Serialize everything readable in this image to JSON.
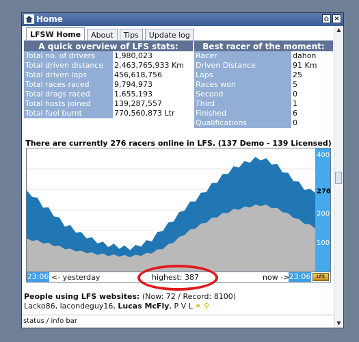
{
  "window": {
    "title": "Home",
    "controls": [
      "⌂",
      "×"
    ]
  },
  "tabs": [
    {
      "label": "LFSW Home",
      "active": true
    },
    {
      "label": "About",
      "active": false
    },
    {
      "label": "Tips",
      "active": false
    },
    {
      "label": "Update log",
      "active": false
    }
  ],
  "overview": {
    "header": "A quick overview of LFS stats:",
    "rows": [
      {
        "label": "Total no. of drivers",
        "value": "1,980,023"
      },
      {
        "label": "Total driven distance",
        "value": "2,463,765,933 Km"
      },
      {
        "label": "Total driven laps",
        "value": "456,618,756"
      },
      {
        "label": "Total races raced",
        "value": "9,794,973"
      },
      {
        "label": "Total drags raced",
        "value": "1,655,193"
      },
      {
        "label": "Total hosts joined",
        "value": "139,287,557"
      },
      {
        "label": "Total fuel burnt",
        "value": "770,560,873 Ltr"
      }
    ]
  },
  "best_racer": {
    "header": "Best racer of the moment:",
    "rows": [
      {
        "label": "Racer",
        "value": "dahon"
      },
      {
        "label": "Driven Distance",
        "value": "91 Km"
      },
      {
        "label": "Laps",
        "value": "25"
      },
      {
        "label": "Races won",
        "value": "5"
      },
      {
        "label": "Second",
        "value": "0"
      },
      {
        "label": "Third",
        "value": "1"
      },
      {
        "label": "Finished",
        "value": "6"
      },
      {
        "label": "Qualifications",
        "value": "0"
      }
    ]
  },
  "online_text": "There are currently 276 racers online in LFS. (137 Demo - 139 Licensed)",
  "graph": {
    "current_label": "276",
    "start_time": "23:06",
    "end_time": "23:06",
    "yesterday_label": "<- yesterday",
    "highest_label": "highest: 387",
    "now_label": "now ->",
    "logo_text": "LFS",
    "colors": {
      "total": "#2177b4",
      "licensed": "#b9b9b9",
      "axis": "#45a9ee",
      "highlight_ring": "#e3181c"
    }
  },
  "chart_data": {
    "type": "area",
    "title": "",
    "xlabel": "",
    "ylabel": "",
    "ylim": [
      0,
      420
    ],
    "yticks": [
      100,
      200,
      276,
      400
    ],
    "ytick_labels": [
      "100",
      "200",
      "276",
      "400"
    ],
    "x_labels": [
      "23:06",
      "23:06"
    ],
    "x": [
      0,
      8,
      16,
      24,
      32,
      40,
      48,
      56,
      64,
      72,
      80,
      88,
      96,
      104,
      112,
      120,
      128,
      136,
      144,
      152,
      160,
      168,
      176,
      184,
      192,
      200,
      208,
      216,
      224,
      232,
      240,
      248,
      256,
      264,
      272,
      280,
      288,
      296,
      304,
      312,
      320,
      328,
      336,
      344,
      352,
      360,
      368,
      376,
      384,
      392,
      400,
      408,
      416,
      424
    ],
    "series": [
      {
        "values": [
          270,
          262,
          245,
          225,
          212,
          195,
          178,
          160,
          152,
          140,
          128,
          120,
          110,
          103,
          95,
          90,
          88,
          85,
          82,
          80,
          84,
          92,
          100,
          110,
          128,
          145,
          160,
          178,
          196,
          215,
          232,
          246,
          262,
          278,
          295,
          310,
          326,
          340,
          352,
          362,
          370,
          378,
          384,
          386,
          380,
          372,
          360,
          345,
          330,
          315,
          300,
          285,
          276,
          276
        ]
      },
      {
        "values": [
          110,
          108,
          104,
          99,
          95,
          90,
          85,
          80,
          75,
          72,
          68,
          66,
          62,
          60,
          58,
          56,
          55,
          54,
          53,
          52,
          54,
          57,
          60,
          65,
          72,
          80,
          90,
          102,
          115,
          128,
          140,
          150,
          160,
          170,
          180,
          188,
          196,
          203,
          210,
          214,
          218,
          222,
          225,
          227,
          225,
          220,
          214,
          206,
          196,
          186,
          176,
          166,
          158,
          150
        ]
      }
    ]
  },
  "people": {
    "header": "People using LFS websites:",
    "counts": "(Now: 72 / Record: 8100)",
    "users_plain": "Lacko86, lacondeguy16, ",
    "users_bold": "Lucas McFly",
    "users_tail": ", P V L"
  },
  "status_bar": "status / info bar"
}
